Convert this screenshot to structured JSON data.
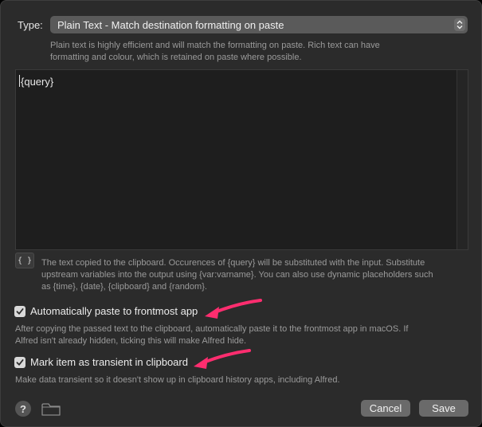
{
  "type_row": {
    "label": "Type:",
    "selected": "Plain Text - Match destination formatting on paste",
    "hint": "Plain text is highly efficient and will match the formatting on paste. Rich text can have formatting and colour, which is retained on paste where possible."
  },
  "editor": {
    "content": "{query}"
  },
  "placeholder_button": {
    "label": "{ }",
    "hint": "The text copied to the clipboard. Occurences of {query} will be substituted with the input. Substitute upstream variables into the output using {var:varname}. You can also use dynamic placeholders such as {time}, {date}, {clipboard} and {random}."
  },
  "options": {
    "auto_paste": {
      "label": "Automatically paste to frontmost app",
      "checked": true,
      "hint": "After copying the passed text to the clipboard, automatically paste it to the frontmost app in macOS. If Alfred isn't already hidden, ticking this will make Alfred hide."
    },
    "transient": {
      "label": "Mark item as transient in clipboard",
      "checked": true,
      "hint": "Make data transient so it doesn't show up in clipboard history apps, including Alfred."
    }
  },
  "footer": {
    "help_label": "?",
    "cancel_label": "Cancel",
    "save_label": "Save"
  },
  "icons": {
    "help": "question-circle-icon",
    "folder": "folder-icon",
    "stepper": "chevron-up-down-icon",
    "check": "checkmark-icon",
    "annotation": "arrow-icon"
  },
  "colors": {
    "window_bg": "#2b2b2b",
    "editor_bg": "#1e1e1e",
    "annotation_arrow": "#ff2d6f",
    "button_bg": "#6a6a6a"
  }
}
